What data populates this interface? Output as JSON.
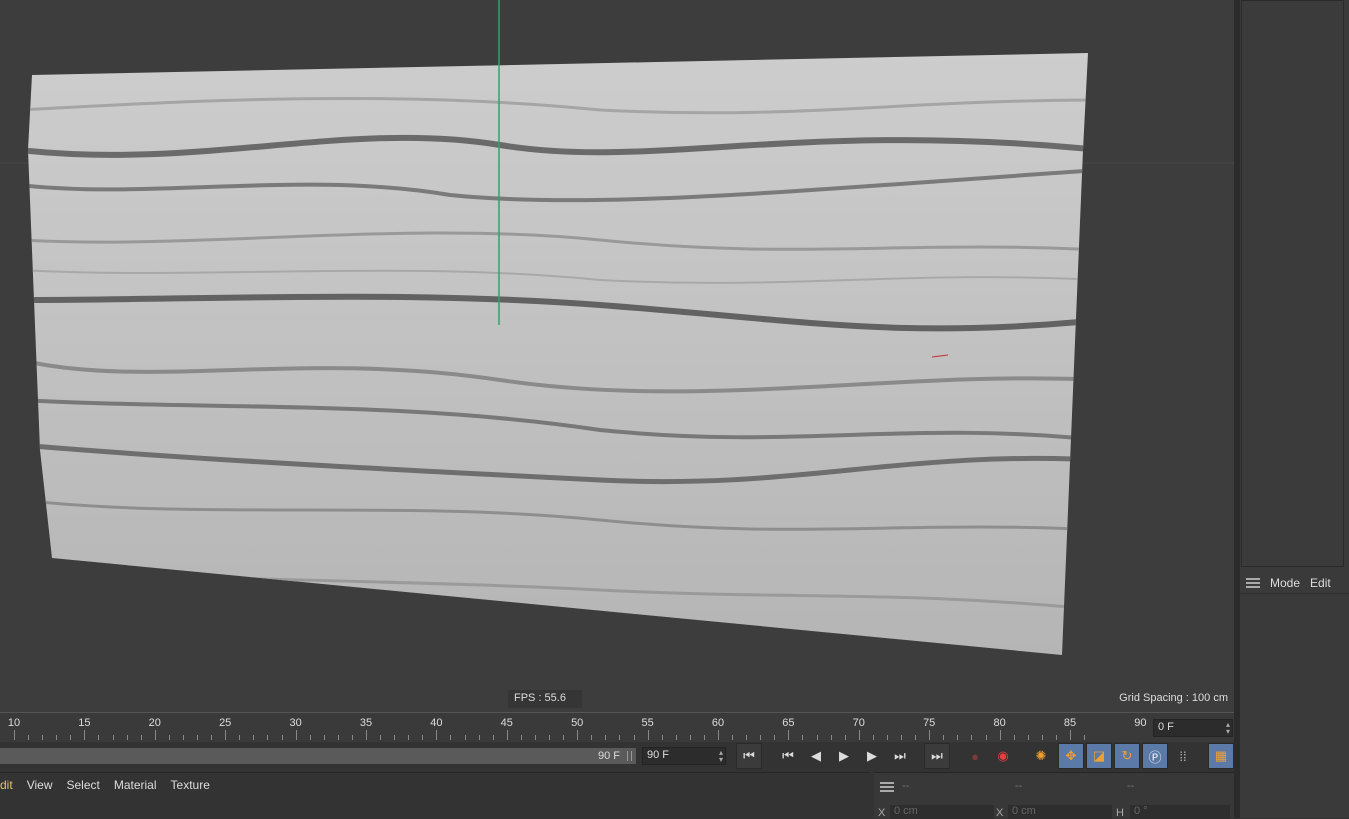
{
  "viewport": {
    "fps_label": "FPS : 55.6",
    "grid_spacing_label": "Grid Spacing : 100 cm"
  },
  "timeline": {
    "ruler_labels": [
      "10",
      "15",
      "20",
      "25",
      "30",
      "35",
      "40",
      "45",
      "50",
      "55",
      "60",
      "65",
      "70",
      "75",
      "80",
      "85",
      "90"
    ],
    "current_frame": "0 F",
    "range_end": "90 F",
    "max_frame": "90 F"
  },
  "transport": {
    "icons": [
      "go-to-start-icon",
      "previous-key-icon",
      "previous-frame-icon",
      "play-icon",
      "next-frame-icon",
      "next-key-icon",
      "go-to-end-icon",
      "record-disabled-icon",
      "autokey-icon",
      "keyframe-selection-icon",
      "move-icon",
      "scale-icon",
      "rotate-icon",
      "parameter-icon",
      "pla-icon",
      "scheme-icon"
    ]
  },
  "material_manager": {
    "menu": [
      "dit",
      "View",
      "Select",
      "Material",
      "Texture"
    ]
  },
  "coordinates": {
    "headers": [
      "--",
      "--",
      "--"
    ],
    "x_label": "X",
    "x_value": "0 cm",
    "x2_label": "X",
    "x2_value": "0 cm",
    "h_label": "H",
    "h_value": "0 °"
  },
  "attributes": {
    "mode_label": "Mode",
    "edit_label": "Edit"
  },
  "colors": {
    "viewport_bg": "#3d3d3d",
    "mesh": "#bfbfbf",
    "axis_green": "#2ea56a",
    "accent_orange": "#f0a030",
    "tool_blue": "#5b7aa8"
  }
}
